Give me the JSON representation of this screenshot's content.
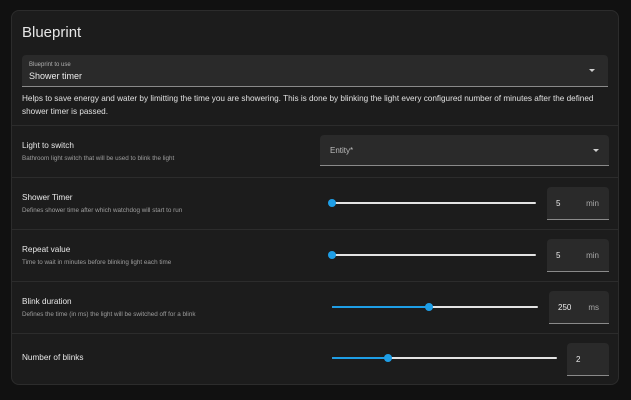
{
  "card": {
    "title": "Blueprint"
  },
  "blueprint_select": {
    "label": "Blueprint to use",
    "value": "Shower timer"
  },
  "description": "Helps to save energy and water by limitting the time you are showering. This is done by blinking the light every configured number of minutes after the defined shower timer is passed.",
  "inputs": {
    "light": {
      "title": "Light to switch",
      "subtitle": "Bathroom light switch that will be used to blink the light",
      "placeholder": "Entity*"
    },
    "shower_timer": {
      "title": "Shower Timer",
      "subtitle": "Defines shower time after which watchdog will start to run",
      "value": "5",
      "unit": "min",
      "slider_fraction": 0.0
    },
    "repeat_value": {
      "title": "Repeat value",
      "subtitle": "Time to wait in minutes before blinking light each time",
      "value": "5",
      "unit": "min",
      "slider_fraction": 0.0
    },
    "blink_duration": {
      "title": "Blink duration",
      "subtitle": "Defines the time (in ms) the light will be switched off for a blink",
      "value": "250",
      "unit": "ms",
      "slider_fraction": 0.47
    },
    "number_of_blinks": {
      "title": "Number of blinks",
      "value": "2",
      "slider_fraction": 0.25
    }
  },
  "colors": {
    "accent": "#1e9ee6",
    "card_bg": "#1c1c1c",
    "page_bg": "#111111"
  }
}
